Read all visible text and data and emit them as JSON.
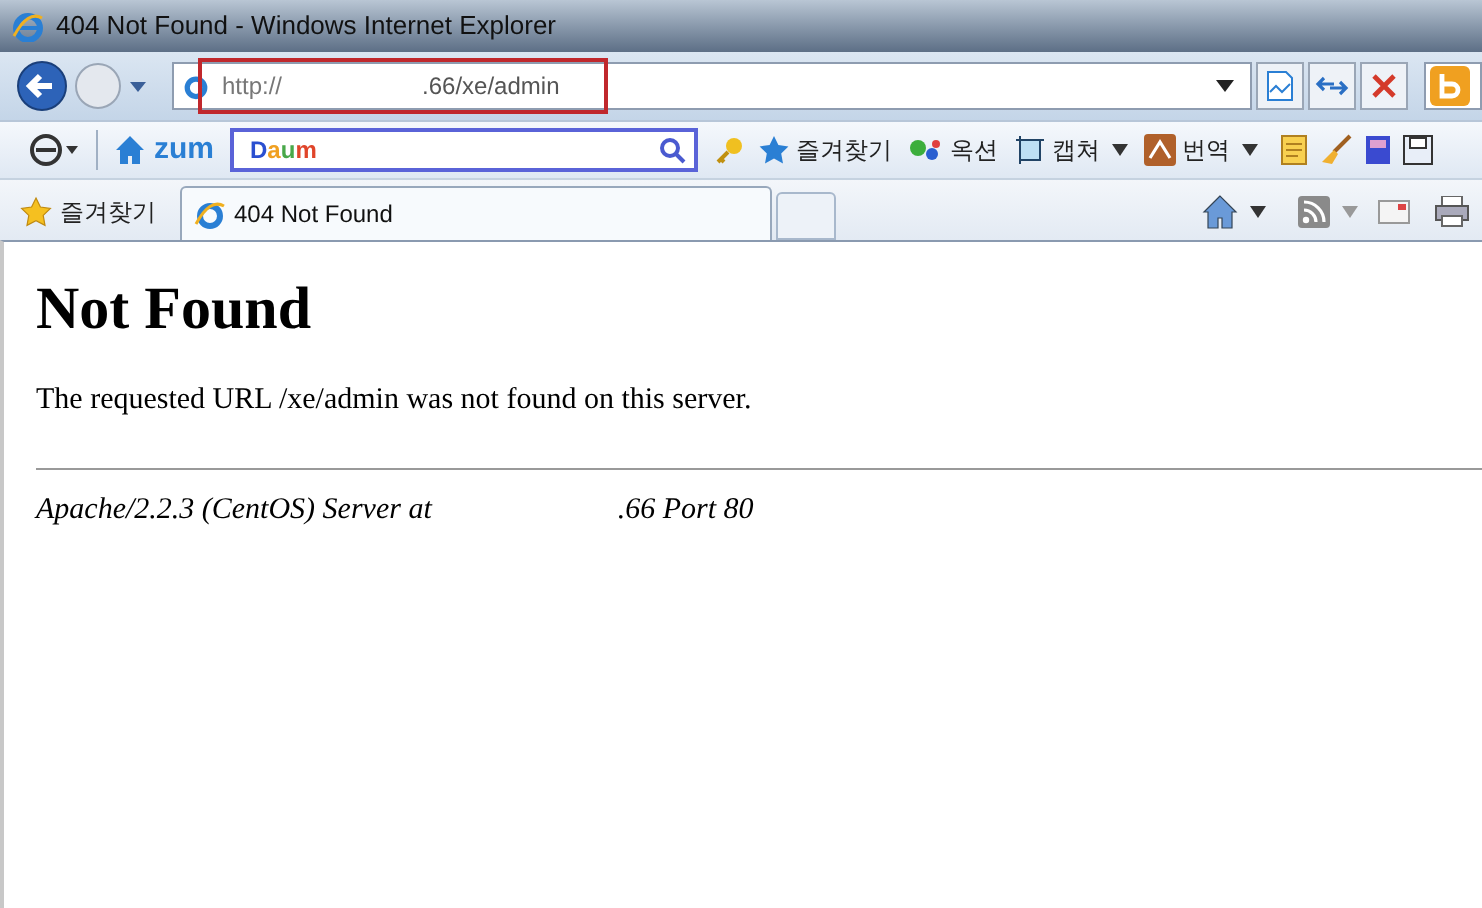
{
  "window": {
    "title": "404 Not Found - Windows Internet Explorer"
  },
  "address_bar": {
    "prefix": "http://",
    "suffix": ".66/xe/admin"
  },
  "toolbar": {
    "logo": "zum",
    "search_logo": "Daum",
    "items": [
      {
        "kind": "favorites",
        "label": "즐겨찾기",
        "has_menu": false
      },
      {
        "kind": "auction",
        "label": "옥션",
        "has_menu": false
      },
      {
        "kind": "capture",
        "label": "캡쳐",
        "has_menu": true
      },
      {
        "kind": "translate",
        "label": "번역",
        "has_menu": true
      }
    ]
  },
  "favorites": {
    "label": "즐겨찾기"
  },
  "tabs": [
    {
      "label": "404 Not Found",
      "selected": true
    }
  ],
  "page": {
    "heading": "Not Found",
    "message": "The requested URL /xe/admin was not found on this server.",
    "footer_prefix": "Apache/2.2.3 (CentOS) Server at",
    "footer_suffix": ".66 Port 80"
  }
}
